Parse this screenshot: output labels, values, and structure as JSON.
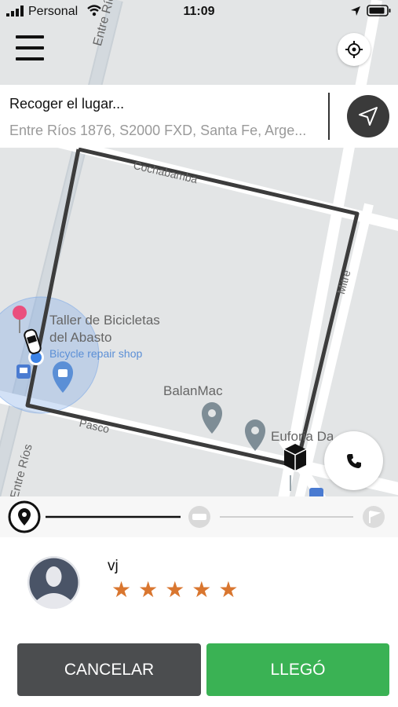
{
  "status_bar": {
    "carrier": "Personal",
    "time": "11:09"
  },
  "pickup": {
    "title": "Recoger el lugar...",
    "address": "Entre Ríos 1876, S2000 FXD, Santa Fe, Arge..."
  },
  "map": {
    "streets": {
      "entre_rios_top": "Entre Ríos",
      "entre_rios_bottom": "Entre Ríos",
      "cochabamba": "Cochabamba",
      "mitre": "Mitre",
      "pasco": "Pasco"
    },
    "places": [
      {
        "name": "Taller de Bicicletas",
        "name2": "del Abasto",
        "category": "Bicycle repair shop"
      },
      {
        "name": "BalanMac"
      },
      {
        "name": "Euforia Da"
      }
    ]
  },
  "driver": {
    "name": "vj",
    "rating_stars": "★★★★★",
    "rating": 5
  },
  "actions": {
    "cancel": "CANCELAR",
    "arrived": "LLEGÓ"
  },
  "colors": {
    "accent_green": "#3ab254",
    "cancel_gray": "#4b4d4f",
    "star": "#d9762f",
    "route": "#3c3c3c"
  },
  "progress": {
    "fraction": 0.45
  }
}
